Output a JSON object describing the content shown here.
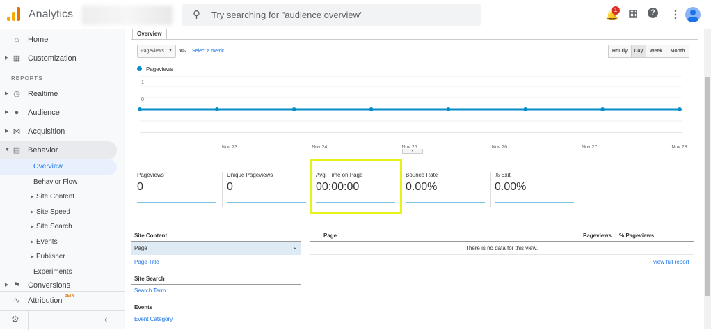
{
  "header": {
    "app_title": "Analytics",
    "search_placeholder": "Try searching for \"audience overview\"",
    "notification_count": "1"
  },
  "sidebar": {
    "items_top": [
      {
        "label": "Home"
      },
      {
        "label": "Customization"
      }
    ],
    "reports_label": "REPORTS",
    "items": [
      {
        "label": "Realtime"
      },
      {
        "label": "Audience"
      },
      {
        "label": "Acquisition"
      },
      {
        "label": "Behavior"
      }
    ],
    "behavior_sub": [
      {
        "label": "Overview"
      },
      {
        "label": "Behavior Flow"
      },
      {
        "label": "Site Content"
      },
      {
        "label": "Site Speed"
      },
      {
        "label": "Site Search"
      },
      {
        "label": "Events"
      },
      {
        "label": "Publisher"
      },
      {
        "label": "Experiments"
      }
    ],
    "conversions": "Conversions",
    "attribution": "Attribution",
    "beta": "BETA"
  },
  "main": {
    "tab": "Overview",
    "metric_select": "Pageviews",
    "vs": "vs.",
    "select_metric": "Select a metric",
    "ranges": [
      "Hourly",
      "Day",
      "Week",
      "Month"
    ],
    "active_range": "Day"
  },
  "chart_data": {
    "type": "line",
    "series": [
      {
        "name": "Pageviews",
        "color": "#058dc7",
        "values": [
          0,
          0,
          0,
          0,
          0,
          0,
          0,
          0
        ]
      }
    ],
    "x_labels": [
      "...",
      "Nov 23",
      "Nov 24",
      "Nov 25",
      "Nov 26",
      "Nov 27",
      "Nov 28"
    ],
    "y_ticks": [
      "1",
      "0"
    ],
    "ylim": [
      0,
      1
    ]
  },
  "metrics": [
    {
      "name": "Pageviews",
      "value": "0"
    },
    {
      "name": "Unique Pageviews",
      "value": "0"
    },
    {
      "name": "Avg. Time on Page",
      "value": "00:00:00"
    },
    {
      "name": "Bounce Rate",
      "value": "0.00%"
    },
    {
      "name": "% Exit",
      "value": "0.00%"
    }
  ],
  "left_table": {
    "site_content": "Site Content",
    "page": "Page",
    "page_title": "Page Title",
    "site_search": "Site Search",
    "search_term": "Search Term",
    "events": "Events",
    "event_category": "Event Category"
  },
  "right_table": {
    "col_page": "Page",
    "col_pageviews": "Pageviews",
    "col_pct": "% Pageviews",
    "empty": "There is no data for this view.",
    "view_full": "view full report"
  }
}
